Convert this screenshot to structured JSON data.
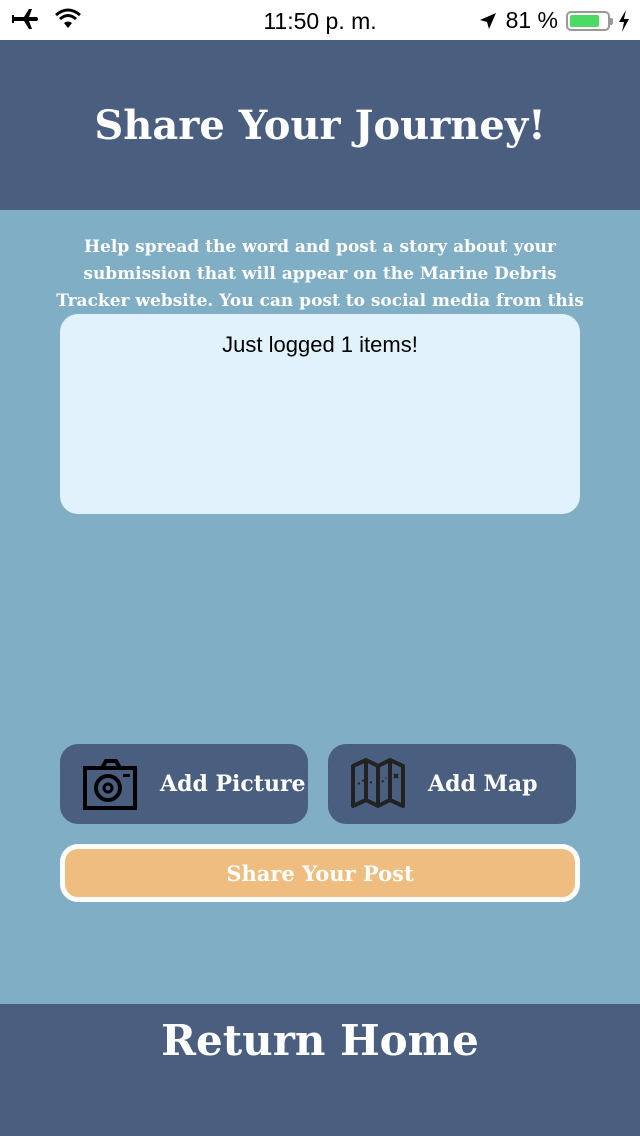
{
  "status_bar": {
    "time": "11:50 p. m.",
    "battery_percent_label": "81 %",
    "battery_level": 0.81,
    "icons": [
      "airplane-icon",
      "wifi-icon",
      "location-arrow-icon",
      "battery-icon",
      "charging-bolt-icon"
    ]
  },
  "header": {
    "title": "Share Your Journey!"
  },
  "description": "Help spread the word and post a story about your submission that will appear on the Marine Debris Tracker website.  You can post to social media from this page.",
  "post_input": {
    "value": "Just logged 1 items!"
  },
  "buttons": {
    "add_picture": "Add Picture",
    "add_map": "Add Map",
    "share": "Share Your Post"
  },
  "footer": {
    "return_home": "Return Home"
  },
  "colors": {
    "header_bg": "#4a5f80",
    "page_bg": "#80aec4",
    "textbox_bg": "#e1f2fd",
    "share_bg": "#eebd7f",
    "battery_fill": "#4cd964"
  }
}
